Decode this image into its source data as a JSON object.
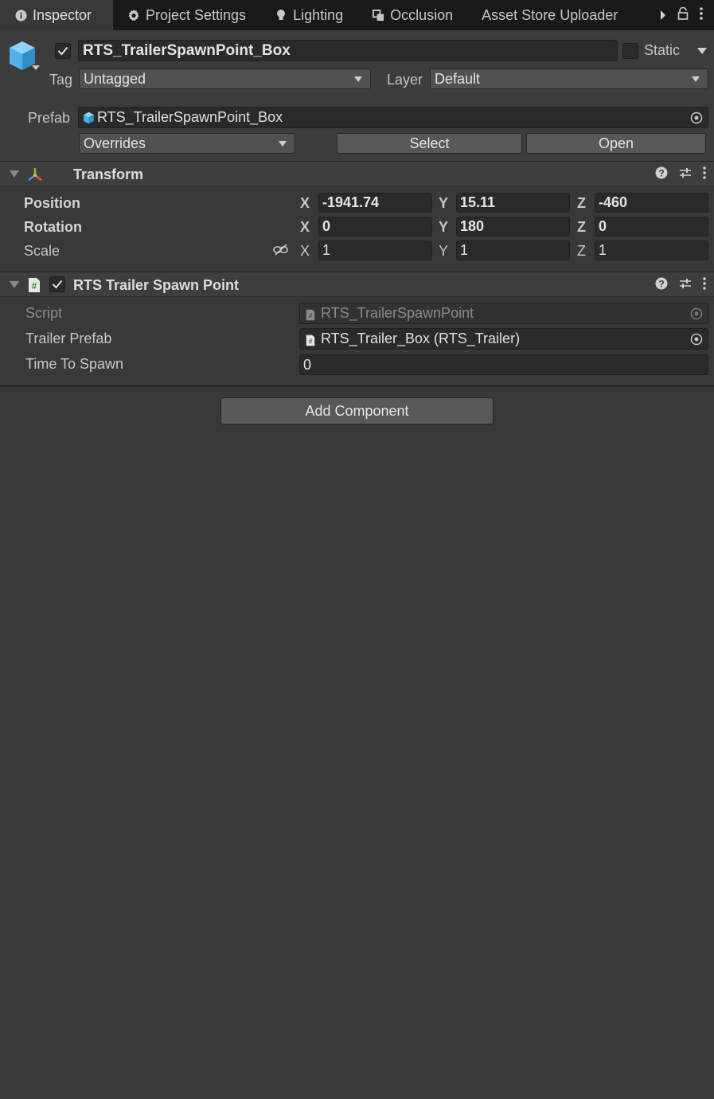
{
  "tabs": [
    {
      "label": "Inspector",
      "icon": "info-icon",
      "active": true
    },
    {
      "label": "Project Settings",
      "icon": "gear-icon",
      "active": false
    },
    {
      "label": "Lighting",
      "icon": "bulb-icon",
      "active": false
    },
    {
      "label": "Occlusion",
      "icon": "occlusion-icon",
      "active": false
    },
    {
      "label": "Asset Store Uploader",
      "icon": "",
      "active": false
    }
  ],
  "header": {
    "object_name": "RTS_TrailerSpawnPoint_Box",
    "active": true,
    "static_label": "Static",
    "static": false,
    "tag_label": "Tag",
    "tag_value": "Untagged",
    "layer_label": "Layer",
    "layer_value": "Default",
    "prefab_label": "Prefab",
    "prefab_value": "RTS_TrailerSpawnPoint_Box",
    "overrides_label": "Overrides",
    "select_label": "Select",
    "open_label": "Open"
  },
  "transform": {
    "title": "Transform",
    "rows": [
      {
        "label": "Position",
        "x": "-1941.74",
        "y": "15.11",
        "z": "-460"
      },
      {
        "label": "Rotation",
        "x": "0",
        "y": "180",
        "z": "0"
      },
      {
        "label": "Scale",
        "x": "1",
        "y": "1",
        "z": "1"
      }
    ],
    "axis_x": "X",
    "axis_y": "Y",
    "axis_z": "Z"
  },
  "spawn_point": {
    "title": "RTS Trailer Spawn Point",
    "enabled": true,
    "script_label": "Script",
    "script_value": "RTS_TrailerSpawnPoint",
    "trailer_prefab_label": "Trailer Prefab",
    "trailer_prefab_value": "RTS_Trailer_Box (RTS_Trailer)",
    "time_to_spawn_label": "Time To Spawn",
    "time_to_spawn_value": "0"
  },
  "add_component_label": "Add Component",
  "colors": {
    "background": "#383838",
    "tabbar": "#191919",
    "field": "#2a2a2a",
    "button": "#585858",
    "prefab_blue": "#4fb3ea"
  }
}
